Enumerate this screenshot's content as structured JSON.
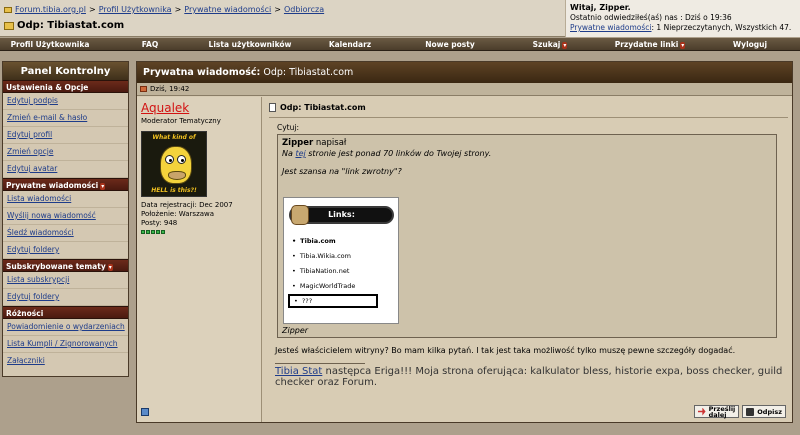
{
  "header": {
    "breadcrumb": [
      "Forum.tibia.org.pl",
      "Profil Użytkownika",
      "Prywatne wiadomości",
      "Odbiorcza"
    ],
    "breadcrumb_sep": ">",
    "page_title": "Odp: Tibiastat.com",
    "user": {
      "greeting": "Witaj, Zipper.",
      "last_visit": "Ostatnio odwiedziłeś(aś) nas : Dziś o 19:36",
      "pm_link": "Prywatne wiadomości",
      "pm_status": ": 1 Nieprzeczytanych, Wszystkich 47."
    }
  },
  "nav": {
    "items": [
      "Profil Użytkownika",
      "FAQ",
      "Lista użytkowników",
      "Kalendarz",
      "Nowe posty",
      "Szukaj",
      "Przydatne linki",
      "Wyloguj"
    ],
    "dropdown_glyph": "▾"
  },
  "sidebar": {
    "title": "Panel Kontrolny",
    "sections": [
      {
        "title": "Ustawienia & Opcje",
        "items": [
          "Edytuj podpis",
          "Zmień e-mail & hasło",
          "Edytuj profil",
          "Zmień opcje",
          "Edytuj avatar"
        ]
      },
      {
        "title": "Prywatne wiadomości",
        "items": [
          "Lista wiadomości",
          "Wyślij nową wiadomość",
          "Śledź wiadomości",
          "Edytuj foldery"
        ]
      },
      {
        "title": "Subskrybowane tematy",
        "items": [
          "Lista subskrypcji",
          "Edytuj foldery"
        ]
      },
      {
        "title": "Różności",
        "items": [
          "Powiadomienie o wydarzeniach",
          "Lista Kumpli / Zignorowanych",
          "Załączniki"
        ]
      }
    ]
  },
  "message": {
    "header_label": "Prywatna wiadomość:",
    "header_subject": "Odp: Tibiastat.com",
    "date": "Dziś, 19:42",
    "author": {
      "name": "Aqualek",
      "role": "Moderator Tematyczny",
      "avatar_top": "What kind of",
      "avatar_bottom": "HELL is this?!",
      "join": "Data rejestracji: Dec 2007",
      "location": "Położenie: Warszawa",
      "posts": "Posty: 948"
    },
    "title": "Odp: Tibiastat.com",
    "quote_label": "Cytuj:",
    "quote": {
      "author": "Zipper",
      "wrote": "napisał",
      "line1_pre": "Na",
      "line1_link": "tej",
      "line1_post": "stronie jest ponad 70 linków do Twojej strony.",
      "line2": "Jest szansa na \"link zwrotny\"?",
      "image_heading": "Links:",
      "image_items": [
        "Tibia.com",
        "Tibia.Wikia.com",
        "TibiaNation.net",
        "MagicWorldTrade"
      ],
      "image_box": "???",
      "signature": "Zipper"
    },
    "body": "Jesteś właścicielem witryny? Bo mam kilka pytań. I tak jest taka możliwość tylko muszę pewne szczegóły dogadać.",
    "signature_link": "Tibia Stat",
    "signature_text": "następca Eriga!!! Moja strona oferująca: kalkulator bless, historie expa, boss checker, guild checker oraz Forum.",
    "buttons": {
      "forward": [
        "Prześlij",
        "dalej"
      ],
      "reply": "Odpisz"
    }
  }
}
